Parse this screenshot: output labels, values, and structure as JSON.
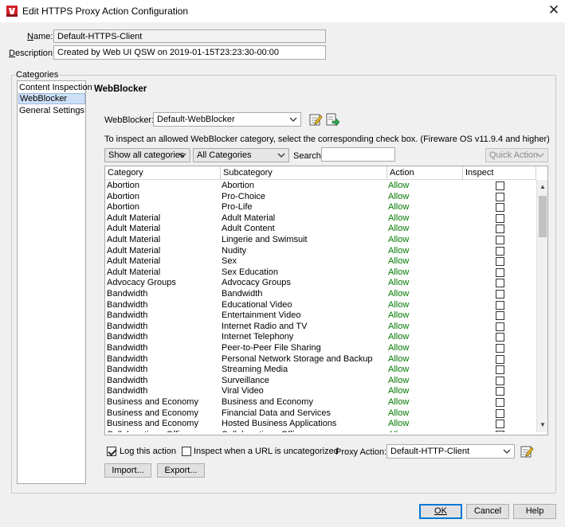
{
  "window": {
    "title": "Edit HTTPS Proxy Action Configuration",
    "close_glyph": "✕",
    "icon": "watchguard-app-icon"
  },
  "form": {
    "name_label_hot": "N",
    "name_label_rest": "ame:",
    "name_value": "Default-HTTPS-Client",
    "description_label_hot": "D",
    "description_label_rest": "escription:",
    "description_value": "Created by Web UI QSW on 2019-01-15T23:23:30-00:00"
  },
  "categories": {
    "legend": "Categories",
    "items": [
      "Content Inspection",
      "WebBlocker",
      "General Settings"
    ],
    "selected_index": 1
  },
  "webblocker": {
    "section_title": "WebBlocker",
    "selector_label": "WebBlocker:",
    "selector_value": "Default-WebBlocker",
    "hint": "To inspect an allowed WebBlocker category, select the corresponding check box. (Fireware OS v11.9.4 and higher)",
    "show_filter_value": "Show all categories",
    "category_filter_value": "All Categories",
    "search_label": "Search:",
    "search_value": "",
    "quick_action_label": "Quick Action"
  },
  "table": {
    "columns": [
      "Category",
      "Subcategory",
      "Action",
      "Inspect"
    ],
    "rows": [
      [
        "Abortion",
        "Abortion",
        "Allow"
      ],
      [
        "Abortion",
        "Pro-Choice",
        "Allow"
      ],
      [
        "Abortion",
        "Pro-Life",
        "Allow"
      ],
      [
        "Adult Material",
        "Adult Material",
        "Allow"
      ],
      [
        "Adult Material",
        "Adult Content",
        "Allow"
      ],
      [
        "Adult Material",
        "Lingerie and Swimsuit",
        "Allow"
      ],
      [
        "Adult Material",
        "Nudity",
        "Allow"
      ],
      [
        "Adult Material",
        "Sex",
        "Allow"
      ],
      [
        "Adult Material",
        "Sex Education",
        "Allow"
      ],
      [
        "Advocacy Groups",
        "Advocacy Groups",
        "Allow"
      ],
      [
        "Bandwidth",
        "Bandwidth",
        "Allow"
      ],
      [
        "Bandwidth",
        "Educational Video",
        "Allow"
      ],
      [
        "Bandwidth",
        "Entertainment Video",
        "Allow"
      ],
      [
        "Bandwidth",
        "Internet Radio and TV",
        "Allow"
      ],
      [
        "Bandwidth",
        "Internet Telephony",
        "Allow"
      ],
      [
        "Bandwidth",
        "Peer-to-Peer File Sharing",
        "Allow"
      ],
      [
        "Bandwidth",
        "Personal Network Storage and Backup",
        "Allow"
      ],
      [
        "Bandwidth",
        "Streaming Media",
        "Allow"
      ],
      [
        "Bandwidth",
        "Surveillance",
        "Allow"
      ],
      [
        "Bandwidth",
        "Viral Video",
        "Allow"
      ],
      [
        "Business and Economy",
        "Business and Economy",
        "Allow"
      ],
      [
        "Business and Economy",
        "Financial Data and Services",
        "Allow"
      ],
      [
        "Business and Economy",
        "Hosted Business Applications",
        "Allow"
      ],
      [
        "Collaboration - Office",
        "Collaboration - Office",
        "Allow"
      ]
    ],
    "allow_color": "#007a00"
  },
  "options": {
    "log_label": "Log this action",
    "log_checked": true,
    "inspect_uncategorized_label": "Inspect when a URL is uncategorized",
    "inspect_uncategorized_checked": false,
    "proxy_action_label": "Proxy Action:",
    "proxy_action_value": "Default-HTTP-Client",
    "import_label": "Import...",
    "export_label": "Export..."
  },
  "footer": {
    "ok_label": "OK",
    "cancel_label": "Cancel",
    "help_label": "Help"
  }
}
